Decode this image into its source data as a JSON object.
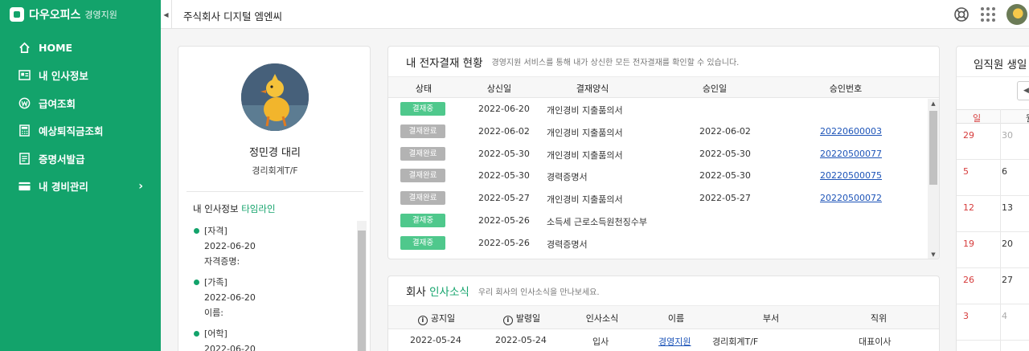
{
  "sidebar": {
    "brand": "다우오피스",
    "brand_sub": "경영지원",
    "items": [
      {
        "label": "HOME",
        "icon": "home-icon"
      },
      {
        "label": "내 인사정보",
        "icon": "id-card-icon"
      },
      {
        "label": "급여조회",
        "icon": "won-coin-icon"
      },
      {
        "label": "예상퇴직금조회",
        "icon": "calculator-icon"
      },
      {
        "label": "증명서발급",
        "icon": "certificate-icon"
      },
      {
        "label": "내 경비관리",
        "icon": "wallet-icon"
      }
    ]
  },
  "topbar": {
    "company": "주식회사 디지털 엠엔씨"
  },
  "profile": {
    "name": "정민경 대리",
    "dept": "경리회계T/F",
    "timeline_title": "내 인사정보",
    "timeline_title_hl": "타임라인",
    "timeline": [
      {
        "type": "[자격]",
        "date": "2022-06-20",
        "detail": "자격증명:"
      },
      {
        "type": "[가족]",
        "date": "2022-06-20",
        "detail": "이름:"
      },
      {
        "type": "[어학]",
        "date": "2022-06-20",
        "detail": ""
      }
    ]
  },
  "approval": {
    "title": "내 전자결재 현황",
    "desc": "경영지원 서비스를 통해 내가 상신한 모든 전자결재를 확인할 수 있습니다.",
    "columns": [
      "상태",
      "상신일",
      "결재양식",
      "승인일",
      "승인번호"
    ],
    "rows": [
      {
        "status": "결재중",
        "tone": "green",
        "submitted": "2022-06-20",
        "form": "개인경비 지출품의서",
        "approved": "",
        "number": ""
      },
      {
        "status": "결재완료",
        "tone": "gray",
        "submitted": "2022-06-02",
        "form": "개인경비 지출품의서",
        "approved": "2022-06-02",
        "number": "20220600003"
      },
      {
        "status": "결재완료",
        "tone": "gray",
        "submitted": "2022-05-30",
        "form": "개인경비 지출품의서",
        "approved": "2022-05-30",
        "number": "20220500077"
      },
      {
        "status": "결재완료",
        "tone": "gray",
        "submitted": "2022-05-30",
        "form": "경력증명서",
        "approved": "2022-05-30",
        "number": "20220500075"
      },
      {
        "status": "결재완료",
        "tone": "gray",
        "submitted": "2022-05-27",
        "form": "개인경비 지출품의서",
        "approved": "2022-05-27",
        "number": "20220500072"
      },
      {
        "status": "결재중",
        "tone": "green",
        "submitted": "2022-05-26",
        "form": "소득세 근로소득원천징수부",
        "approved": "",
        "number": ""
      },
      {
        "status": "결재중",
        "tone": "green",
        "submitted": "2022-05-26",
        "form": "경력증명서",
        "approved": "",
        "number": ""
      }
    ]
  },
  "news": {
    "title": "회사",
    "title_hl": "인사소식",
    "desc": "우리 회사의 인사소식을 만나보세요.",
    "columns": [
      "공지일",
      "발령일",
      "인사소식",
      "이름",
      "부서",
      "직위"
    ],
    "rows": [
      {
        "notice": "2022-05-24",
        "issued": "2022-05-24",
        "kind": "입사",
        "name": "경영지원",
        "dept": "경리회계T/F",
        "position": "대표이사"
      }
    ]
  },
  "birthday": {
    "title": "임직원 생일",
    "weekdays": [
      "일",
      "월"
    ],
    "weeks": [
      [
        "29",
        "30"
      ],
      [
        "5",
        "6"
      ],
      [
        "12",
        "13"
      ],
      [
        "19",
        "20"
      ],
      [
        "26",
        "27"
      ],
      [
        "3",
        "4"
      ]
    ]
  },
  "colors": {
    "sidebar": "#13a36b",
    "badge_pending": "#4fc88c",
    "badge_done": "#b3b3b3",
    "link": "#1d54b8"
  }
}
